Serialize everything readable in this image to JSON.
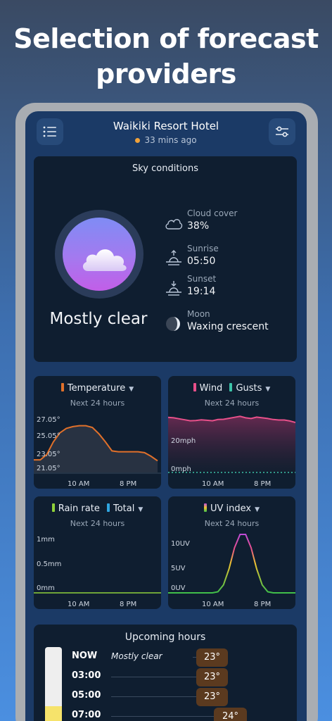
{
  "headline": "Selection of forecast providers",
  "app": {
    "location": "Waikiki Resort Hotel",
    "updated": "33 mins ago",
    "menu_icon": "list-icon",
    "settings_icon": "sliders-icon"
  },
  "sky": {
    "title": "Sky conditions",
    "condition": "Mostly clear",
    "stats": [
      {
        "label": "Cloud cover",
        "value": "38%",
        "icon": "cloud-icon"
      },
      {
        "label": "Sunrise",
        "value": "05:50",
        "icon": "sunrise-icon"
      },
      {
        "label": "Sunset",
        "value": "19:14",
        "icon": "sunset-icon"
      },
      {
        "label": "Moon",
        "value": "Waxing crescent",
        "icon": "moon-icon"
      }
    ]
  },
  "colors": {
    "temperature": "#e0702a",
    "wind": "#e8508a",
    "gusts": "#3cc3a8",
    "rain_rate": "#8fd13a",
    "total": "#2fa6e0",
    "uv_low": "#3fbf4a",
    "uv_mid": "#f0c530",
    "uv_high": "#c04bd8"
  },
  "charts": {
    "temperature": {
      "title": "Temperature",
      "subtitle": "Next 24 hours",
      "y_ticks": [
        "27.05°",
        "25.05°",
        "23.05°",
        "21.05°"
      ],
      "x_ticks": [
        "10 AM",
        "8 PM"
      ]
    },
    "wind": {
      "title": "Wind",
      "title2": "Gusts",
      "subtitle": "Next 24 hours",
      "y_ticks": [
        "20mph",
        "0mph"
      ],
      "x_ticks": [
        "10 AM",
        "8 PM"
      ]
    },
    "rain": {
      "title": "Rain rate",
      "title2": "Total",
      "subtitle": "Next 24 hours",
      "y_ticks": [
        "1mm",
        "0.5mm",
        "0mm"
      ],
      "x_ticks": [
        "10 AM",
        "8 PM"
      ]
    },
    "uv": {
      "title": "UV index",
      "subtitle": "Next 24 hours",
      "y_ticks": [
        "10UV",
        "5UV",
        "0UV"
      ],
      "x_ticks": [
        "10 AM",
        "8 PM"
      ]
    }
  },
  "chart_data": [
    {
      "type": "area",
      "title": "Temperature",
      "ylim": [
        21,
        27.5
      ],
      "x": [
        0,
        1,
        2,
        3,
        4,
        5,
        6,
        7,
        8,
        9,
        10,
        11,
        12,
        13,
        14,
        15,
        16,
        17,
        18,
        19,
        20,
        21,
        22,
        23
      ],
      "values": [
        22.4,
        22.4,
        23.0,
        24.4,
        25.4,
        25.9,
        26.1,
        26.2,
        26.2,
        26.0,
        25.3,
        24.4,
        23.4,
        23.3,
        23.3,
        23.3,
        23.3,
        23.2,
        22.8,
        22.3
      ]
    },
    {
      "type": "area",
      "title": "Wind",
      "ylim": [
        0,
        28
      ],
      "values": [
        22.6,
        22.4,
        22.0,
        21.6,
        21.2,
        21.3,
        21.6,
        21.4,
        21.2,
        21.7,
        21.8,
        22.2,
        22.6,
        23.0,
        22.4,
        22.1,
        22.7,
        22.4,
        22.1,
        21.7,
        21.5,
        21.5,
        21.1,
        20.5
      ],
      "gusts": [
        0,
        0,
        0,
        0,
        0,
        0,
        0,
        0,
        0,
        0,
        0,
        0,
        0,
        0,
        0,
        0,
        0,
        0,
        0,
        0,
        0,
        0,
        0,
        0
      ]
    },
    {
      "type": "line",
      "title": "Rain rate",
      "ylim": [
        0,
        1
      ],
      "values": [
        0,
        0,
        0,
        0,
        0,
        0,
        0,
        0,
        0,
        0,
        0,
        0,
        0,
        0,
        0,
        0,
        0,
        0,
        0,
        0,
        0,
        0,
        0,
        0
      ]
    },
    {
      "type": "line",
      "title": "UV index",
      "ylim": [
        0,
        11
      ],
      "values": [
        0,
        0,
        0,
        0,
        0,
        0,
        0,
        0,
        0,
        0.2,
        1.5,
        4.5,
        8.5,
        11,
        11,
        8.5,
        4.5,
        1.5,
        0.2,
        0,
        0,
        0,
        0,
        0
      ]
    }
  ],
  "upcoming": {
    "title": "Upcoming hours",
    "rows": [
      {
        "time": "NOW",
        "condition": "Mostly clear",
        "temp": "23°"
      },
      {
        "time": "03:00",
        "condition": "",
        "temp": "23°"
      },
      {
        "time": "05:00",
        "condition": "",
        "temp": "23°"
      },
      {
        "time": "07:00",
        "condition": "",
        "temp": "24°"
      }
    ]
  }
}
